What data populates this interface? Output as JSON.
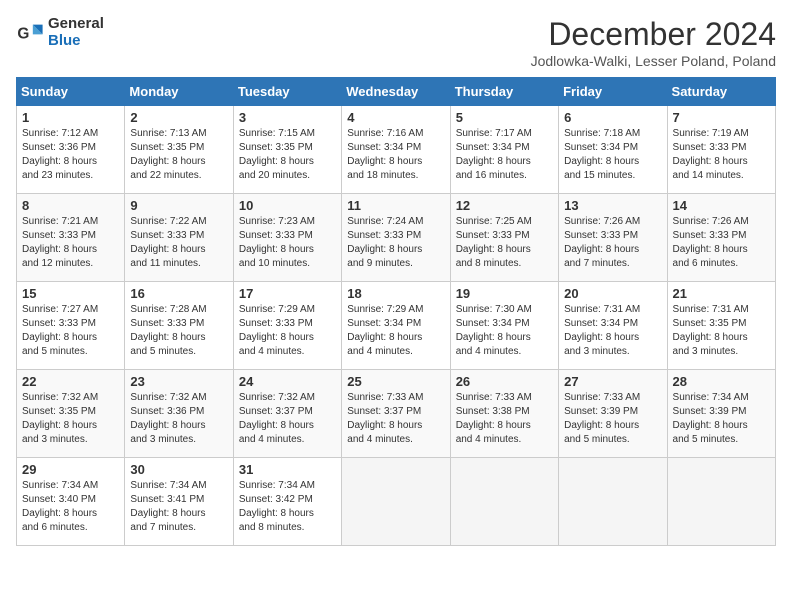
{
  "header": {
    "logo_line1": "General",
    "logo_line2": "Blue",
    "title": "December 2024",
    "location": "Jodlowka-Walki, Lesser Poland, Poland"
  },
  "columns": [
    "Sunday",
    "Monday",
    "Tuesday",
    "Wednesday",
    "Thursday",
    "Friday",
    "Saturday"
  ],
  "weeks": [
    [
      {
        "day": "1",
        "rise": "7:12 AM",
        "set": "3:36 PM",
        "daylight": "8 hours and 23 minutes."
      },
      {
        "day": "2",
        "rise": "7:13 AM",
        "set": "3:35 PM",
        "daylight": "8 hours and 22 minutes."
      },
      {
        "day": "3",
        "rise": "7:15 AM",
        "set": "3:35 PM",
        "daylight": "8 hours and 20 minutes."
      },
      {
        "day": "4",
        "rise": "7:16 AM",
        "set": "3:34 PM",
        "daylight": "8 hours and 18 minutes."
      },
      {
        "day": "5",
        "rise": "7:17 AM",
        "set": "3:34 PM",
        "daylight": "8 hours and 16 minutes."
      },
      {
        "day": "6",
        "rise": "7:18 AM",
        "set": "3:34 PM",
        "daylight": "8 hours and 15 minutes."
      },
      {
        "day": "7",
        "rise": "7:19 AM",
        "set": "3:33 PM",
        "daylight": "8 hours and 14 minutes."
      }
    ],
    [
      {
        "day": "8",
        "rise": "7:21 AM",
        "set": "3:33 PM",
        "daylight": "8 hours and 12 minutes."
      },
      {
        "day": "9",
        "rise": "7:22 AM",
        "set": "3:33 PM",
        "daylight": "8 hours and 11 minutes."
      },
      {
        "day": "10",
        "rise": "7:23 AM",
        "set": "3:33 PM",
        "daylight": "8 hours and 10 minutes."
      },
      {
        "day": "11",
        "rise": "7:24 AM",
        "set": "3:33 PM",
        "daylight": "8 hours and 9 minutes."
      },
      {
        "day": "12",
        "rise": "7:25 AM",
        "set": "3:33 PM",
        "daylight": "8 hours and 8 minutes."
      },
      {
        "day": "13",
        "rise": "7:26 AM",
        "set": "3:33 PM",
        "daylight": "8 hours and 7 minutes."
      },
      {
        "day": "14",
        "rise": "7:26 AM",
        "set": "3:33 PM",
        "daylight": "8 hours and 6 minutes."
      }
    ],
    [
      {
        "day": "15",
        "rise": "7:27 AM",
        "set": "3:33 PM",
        "daylight": "8 hours and 5 minutes."
      },
      {
        "day": "16",
        "rise": "7:28 AM",
        "set": "3:33 PM",
        "daylight": "8 hours and 5 minutes."
      },
      {
        "day": "17",
        "rise": "7:29 AM",
        "set": "3:33 PM",
        "daylight": "8 hours and 4 minutes."
      },
      {
        "day": "18",
        "rise": "7:29 AM",
        "set": "3:34 PM",
        "daylight": "8 hours and 4 minutes."
      },
      {
        "day": "19",
        "rise": "7:30 AM",
        "set": "3:34 PM",
        "daylight": "8 hours and 4 minutes."
      },
      {
        "day": "20",
        "rise": "7:31 AM",
        "set": "3:34 PM",
        "daylight": "8 hours and 3 minutes."
      },
      {
        "day": "21",
        "rise": "7:31 AM",
        "set": "3:35 PM",
        "daylight": "8 hours and 3 minutes."
      }
    ],
    [
      {
        "day": "22",
        "rise": "7:32 AM",
        "set": "3:35 PM",
        "daylight": "8 hours and 3 minutes."
      },
      {
        "day": "23",
        "rise": "7:32 AM",
        "set": "3:36 PM",
        "daylight": "8 hours and 3 minutes."
      },
      {
        "day": "24",
        "rise": "7:32 AM",
        "set": "3:37 PM",
        "daylight": "8 hours and 4 minutes."
      },
      {
        "day": "25",
        "rise": "7:33 AM",
        "set": "3:37 PM",
        "daylight": "8 hours and 4 minutes."
      },
      {
        "day": "26",
        "rise": "7:33 AM",
        "set": "3:38 PM",
        "daylight": "8 hours and 4 minutes."
      },
      {
        "day": "27",
        "rise": "7:33 AM",
        "set": "3:39 PM",
        "daylight": "8 hours and 5 minutes."
      },
      {
        "day": "28",
        "rise": "7:34 AM",
        "set": "3:39 PM",
        "daylight": "8 hours and 5 minutes."
      }
    ],
    [
      {
        "day": "29",
        "rise": "7:34 AM",
        "set": "3:40 PM",
        "daylight": "8 hours and 6 minutes."
      },
      {
        "day": "30",
        "rise": "7:34 AM",
        "set": "3:41 PM",
        "daylight": "8 hours and 7 minutes."
      },
      {
        "day": "31",
        "rise": "7:34 AM",
        "set": "3:42 PM",
        "daylight": "8 hours and 8 minutes."
      },
      null,
      null,
      null,
      null
    ]
  ]
}
